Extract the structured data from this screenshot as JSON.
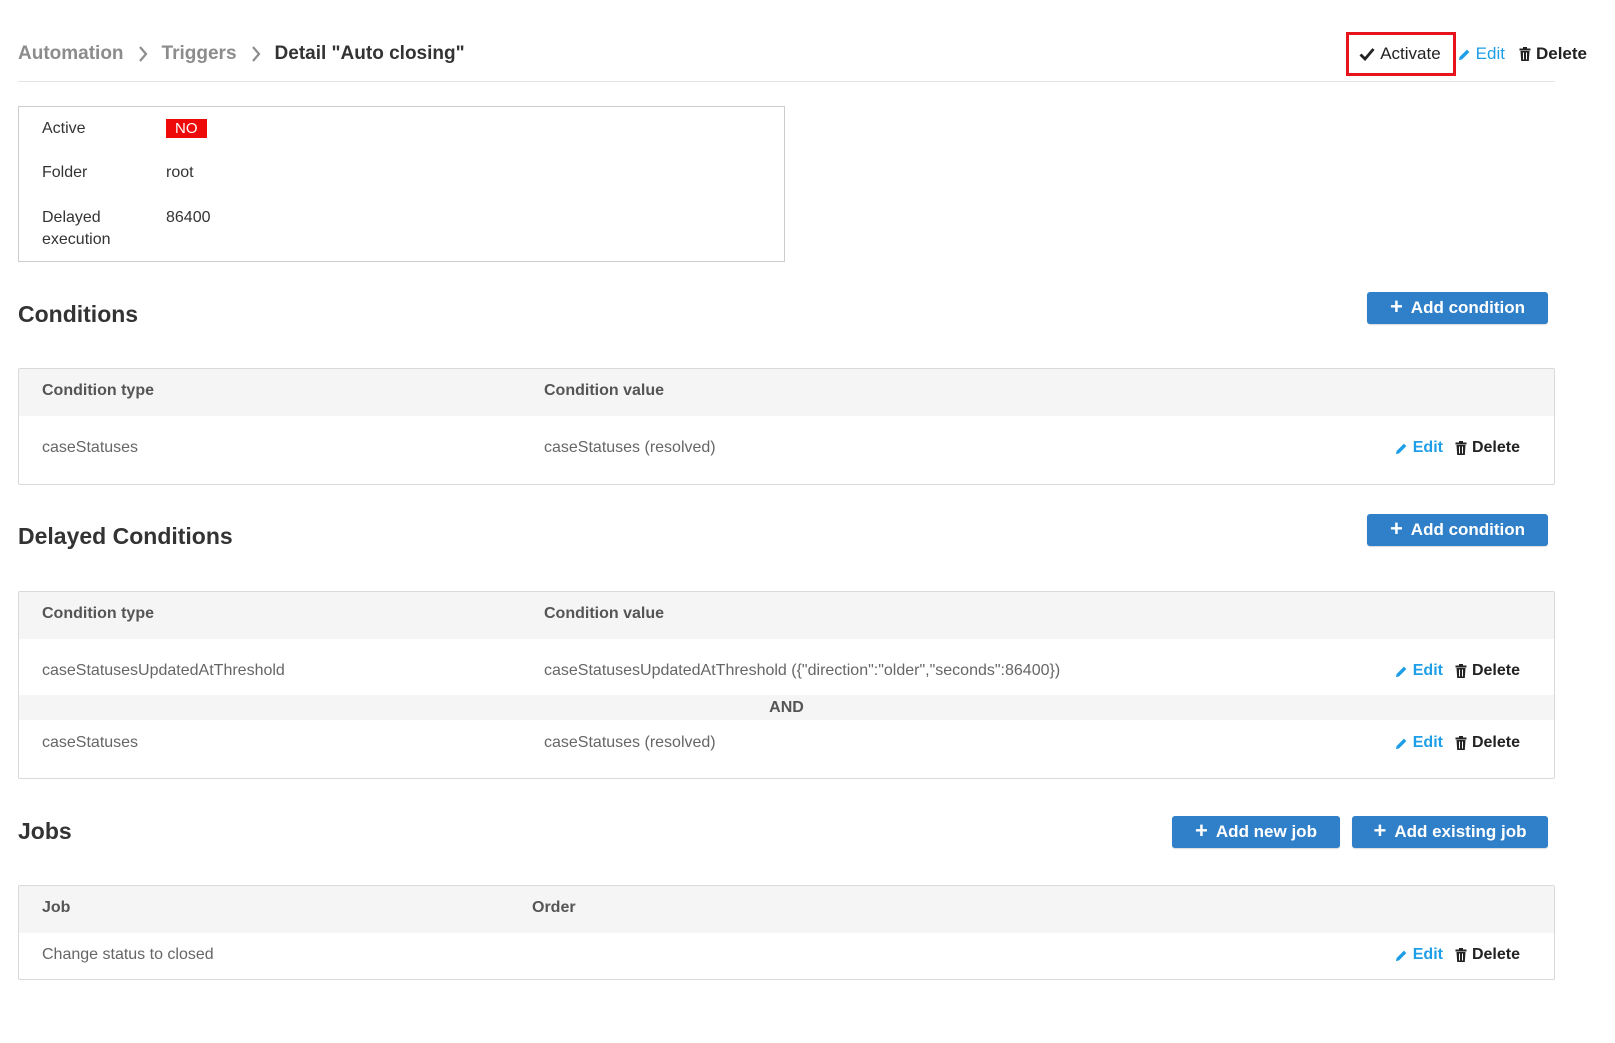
{
  "breadcrumb": {
    "items": [
      "Automation",
      "Triggers"
    ],
    "current": "Detail \"Auto closing\""
  },
  "top_actions": {
    "activate": "Activate",
    "edit": "Edit",
    "delete": "Delete"
  },
  "info": {
    "active_label": "Active",
    "active_value": "NO",
    "folder_label": "Folder",
    "folder_value": "root",
    "delayed_label": "Delayed execution",
    "delayed_value": "86400"
  },
  "conditions": {
    "title": "Conditions",
    "add_button": "Add condition",
    "columns": [
      "Condition type",
      "Condition value"
    ],
    "rows": [
      {
        "type": "caseStatuses",
        "value": "caseStatuses (resolved)",
        "edit": "Edit",
        "delete": "Delete"
      }
    ]
  },
  "delayed_conditions": {
    "title": "Delayed Conditions",
    "add_button": "Add condition",
    "columns": [
      "Condition type",
      "Condition value"
    ],
    "rows": [
      {
        "type": "caseStatusesUpdatedAtThreshold",
        "value": "caseStatusesUpdatedAtThreshold ({\"direction\":\"older\",\"seconds\":86400})",
        "edit": "Edit",
        "delete": "Delete"
      },
      {
        "type": "caseStatuses",
        "value": "caseStatuses (resolved)",
        "edit": "Edit",
        "delete": "Delete"
      }
    ],
    "separator": "AND"
  },
  "jobs": {
    "title": "Jobs",
    "add_new_button": "Add new job",
    "add_existing_button": "Add existing job",
    "columns": [
      "Job",
      "Order"
    ],
    "rows": [
      {
        "job": "Change status to closed",
        "order": "",
        "edit": "Edit",
        "delete": "Delete"
      }
    ]
  },
  "colors": {
    "primary": "#2f7fc9",
    "link": "#1e9ee6",
    "badge_inactive": "#ef0a0a",
    "highlight": "#e8141c"
  }
}
